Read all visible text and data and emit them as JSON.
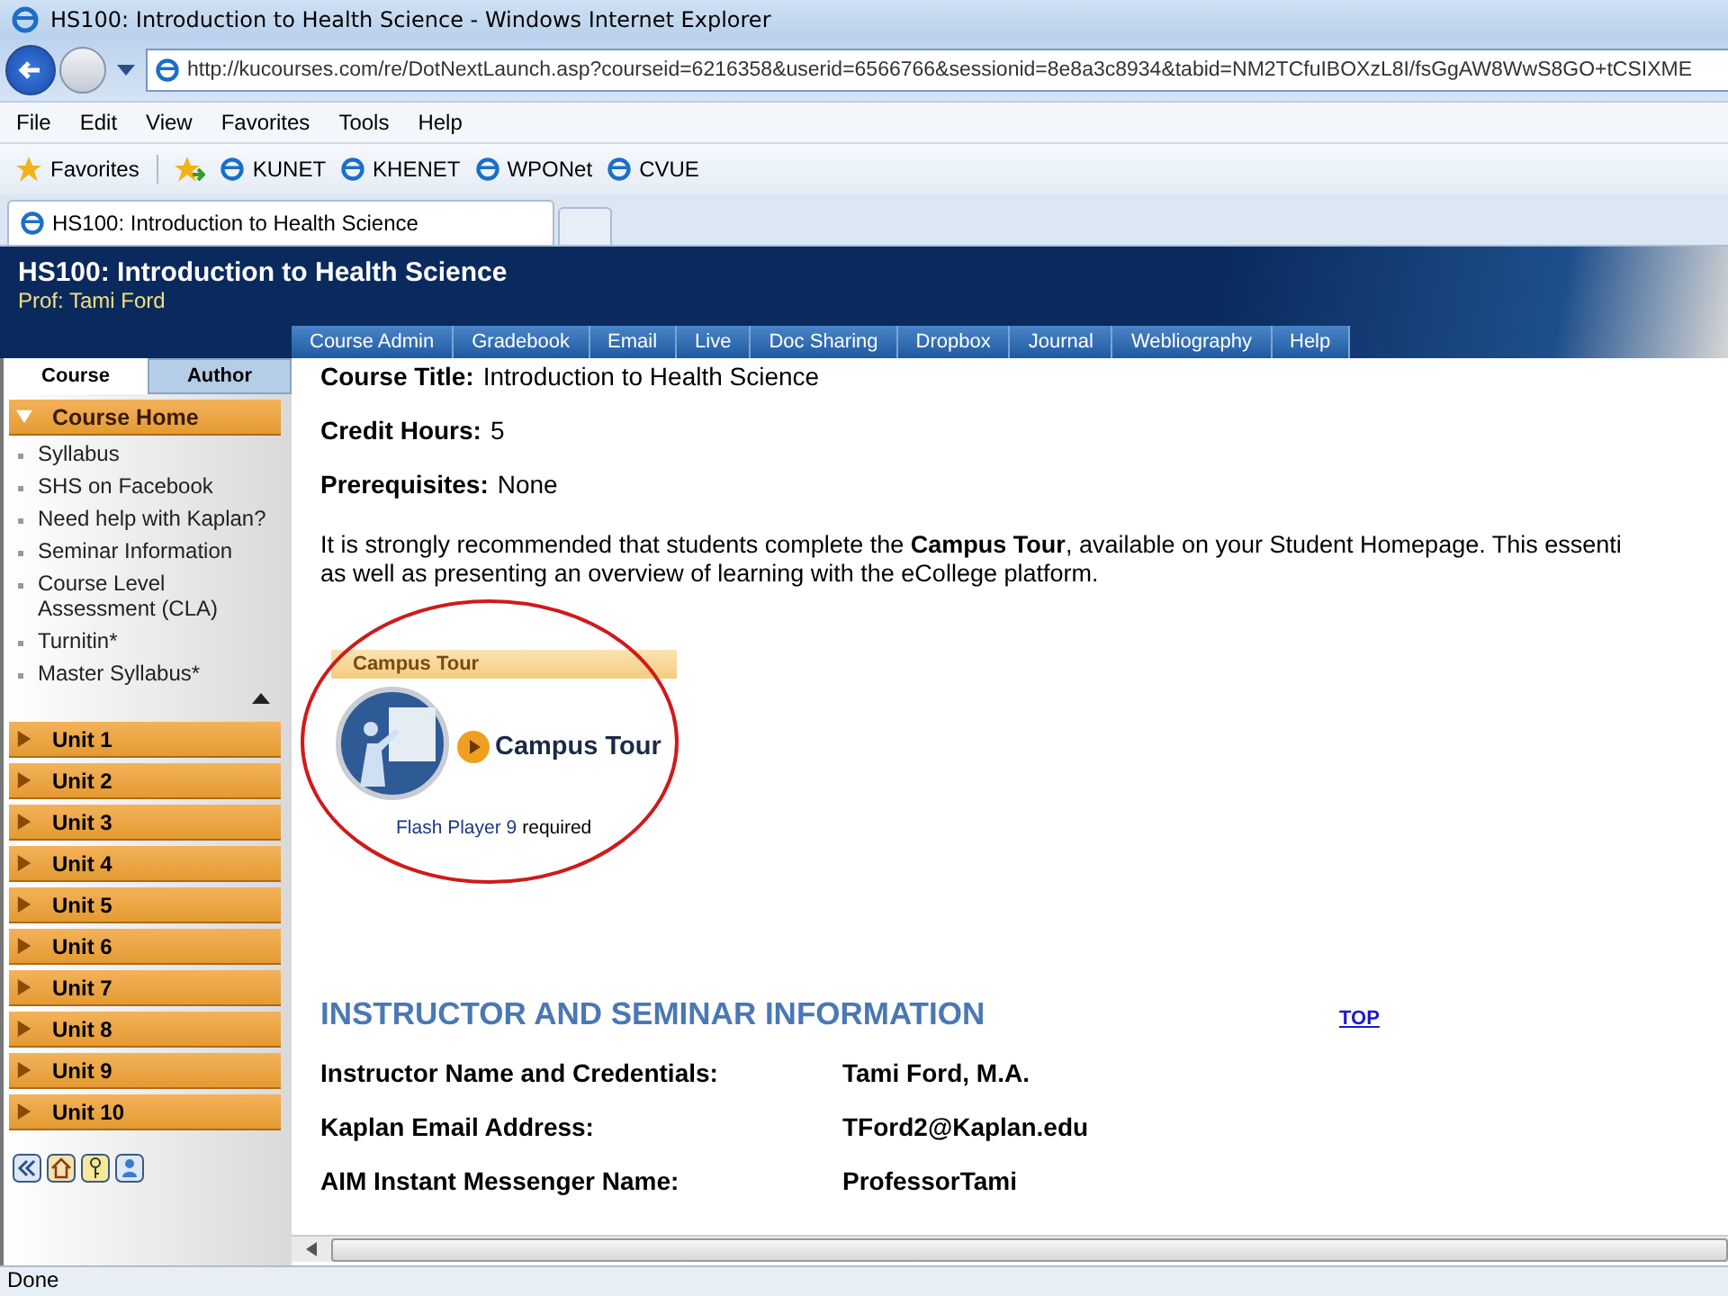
{
  "window": {
    "title": "HS100: Introduction to Health Science - Windows Internet Explorer"
  },
  "address": "http://kucourses.com/re/DotNextLaunch.asp?courseid=6216358&userid=6566766&sessionid=8e8a3c8934&tabid=NM2TCfuIBOXzL8I/fsGgAW8WwS8GO+tCSIXME",
  "menu": [
    "File",
    "Edit",
    "View",
    "Favorites",
    "Tools",
    "Help"
  ],
  "favorites_bar": {
    "label": "Favorites",
    "links": [
      "KUNET",
      "KHENET",
      "WPONet",
      "CVUE"
    ]
  },
  "tabs": [
    {
      "label": "HS100: Introduction to Health Science",
      "selected": true
    }
  ],
  "header": {
    "title": "HS100: Introduction to Health Science",
    "professor": "Prof:  Tami Ford"
  },
  "nav": [
    "Course Admin",
    "Gradebook",
    "Email",
    "Live",
    "Doc Sharing",
    "Dropbox",
    "Journal",
    "Webliography",
    "Help"
  ],
  "sidebar": {
    "tabs": [
      {
        "label": "Course",
        "selected": true
      },
      {
        "label": "Author",
        "selected": false
      }
    ],
    "home": {
      "label": "Course Home",
      "expanded": true
    },
    "items": [
      "Syllabus",
      "SHS on Facebook",
      "Need help with Kaplan?",
      "Seminar Information",
      "Course Level Assessment (CLA)",
      "Turnitin*",
      "Master Syllabus*"
    ],
    "units": [
      {
        "label": "Unit 1",
        "expanded": false
      },
      {
        "label": "Unit 2",
        "expanded": false
      },
      {
        "label": "Unit 3",
        "expanded": false
      },
      {
        "label": "Unit 4",
        "expanded": false
      },
      {
        "label": "Unit 5",
        "expanded": false
      },
      {
        "label": "Unit 6",
        "expanded": false
      },
      {
        "label": "Unit 7",
        "expanded": false
      },
      {
        "label": "Unit 8",
        "expanded": false
      },
      {
        "label": "Unit 9",
        "expanded": false
      },
      {
        "label": "Unit 10",
        "expanded": false
      }
    ]
  },
  "content": {
    "fields": [
      {
        "label": "Course Title:",
        "value": "Introduction to Health Science"
      },
      {
        "label": "Credit Hours:",
        "value": "5"
      },
      {
        "label": "Prerequisites:",
        "value": "None"
      }
    ],
    "paragraph": [
      "It is strongly recommended that students complete the **Campus Tour**, available on your Student Homepage. This essenti",
      "as well as presenting an overview of learning with the eCollege platform."
    ],
    "campus_tour": {
      "header": "Campus Tour",
      "button": "Campus Tour",
      "link": "Flash Player 9",
      "note": "required"
    },
    "section": {
      "heading": "INSTRUCTOR AND SEMINAR INFORMATION",
      "top_link": "TOP",
      "rows": [
        {
          "label": "Instructor Name and Credentials:",
          "value": "Tami Ford, M.A."
        },
        {
          "label": "Kaplan Email Address:",
          "value": "TFord2@Kaplan.edu"
        },
        {
          "label": "AIM Instant Messenger Name:",
          "value": "ProfessorTami"
        }
      ]
    }
  },
  "status_bar": "Done"
}
